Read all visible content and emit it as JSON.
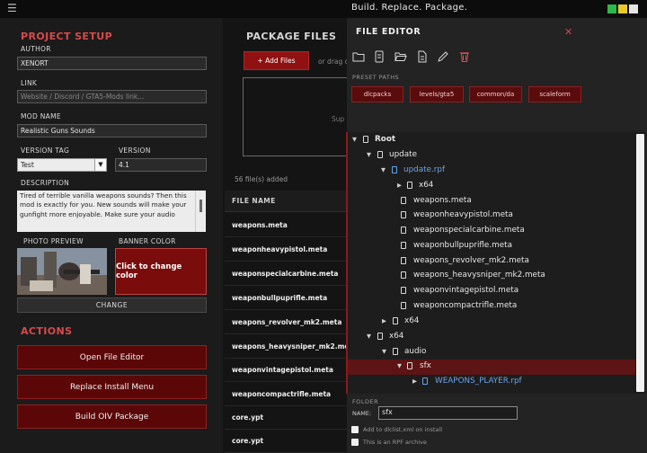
{
  "titlebar": {
    "app_title": "Build. Replace. Package.",
    "window_squares": [
      {
        "name": "green",
        "color": "#2fb84a"
      },
      {
        "name": "yellow",
        "color": "#e8c92a"
      },
      {
        "name": "white",
        "color": "#e6e6e6"
      }
    ]
  },
  "setup": {
    "title": "PROJECT SETUP",
    "author": {
      "label": "AUTHOR",
      "value": "XENORT"
    },
    "link": {
      "label": "LINK",
      "placeholder": "Website / Discord / GTA5-Mods link..."
    },
    "mod_name": {
      "label": "MOD NAME",
      "value": "Realistic Guns Sounds"
    },
    "version_tag": {
      "label": "VERSION TAG",
      "value": "Test"
    },
    "version": {
      "label": "VERSION",
      "value": "4.1"
    },
    "description": {
      "label": "DESCRIPTION",
      "value": "Tired of terrible vanilla weapons sounds? Then this mod is exactly for you. New sounds will make your gunfight more enjoyable. Make sure your audio"
    },
    "photo_preview_label": "PHOTO PREVIEW",
    "banner_color_label": "BANNER COLOR",
    "banner_button": "Click to change color",
    "change_button": "CHANGE"
  },
  "actions": {
    "title": "ACTIONS",
    "open_editor": "Open File Editor",
    "replace_menu": "Replace Install Menu",
    "build_oiv": "Build OIV Package"
  },
  "package": {
    "title": "PACKAGE FILES",
    "add_button": "+ Add Files",
    "drop_hint": "or drag o",
    "drop_sub": "Sup",
    "file_count": "56 file(s) added",
    "column_header": "FILE NAME",
    "files": [
      "weapons.meta",
      "weaponheavypistol.meta",
      "weaponspecialcarbine.meta",
      "weaponbullpuprifle.meta",
      "weapons_revolver_mk2.meta",
      "weapons_heavysniper_mk2.meta",
      "weaponvintagepistol.meta",
      "weaponcompactrifle.meta",
      "core.ypt",
      "core.ypt"
    ]
  },
  "editor": {
    "title": "FILE EDITOR",
    "toolbar": [
      "new-folder-icon",
      "new-file-icon",
      "open-folder-icon",
      "document-icon",
      "rename-pencil-icon",
      "delete-trash-icon"
    ],
    "preset_label": "PRESET PATHS",
    "presets": [
      "dlcpacks",
      "levels/gta5",
      "common/da",
      "scaleform"
    ],
    "tree": [
      {
        "label": "Root",
        "arrow": "▼",
        "style": "bold"
      },
      {
        "label": "update",
        "arrow": "▼",
        "style": ""
      },
      {
        "label": "update.rpf",
        "arrow": "▼",
        "style": "blue"
      },
      {
        "label": "x64",
        "arrow": "▶",
        "style": ""
      },
      {
        "label": "weapons.meta",
        "arrow": "",
        "style": ""
      },
      {
        "label": "weaponheavypistol.meta",
        "arrow": "",
        "style": ""
      },
      {
        "label": "weaponspecialcarbine.meta",
        "arrow": "",
        "style": ""
      },
      {
        "label": "weaponbullpuprifle.meta",
        "arrow": "",
        "style": ""
      },
      {
        "label": "weapons_revolver_mk2.meta",
        "arrow": "",
        "style": ""
      },
      {
        "label": "weapons_heavysniper_mk2.meta",
        "arrow": "",
        "style": ""
      },
      {
        "label": "weaponvintagepistol.meta",
        "arrow": "",
        "style": ""
      },
      {
        "label": "weaponcompactrifle.meta",
        "arrow": "",
        "style": ""
      },
      {
        "label": "x64",
        "arrow": "▶",
        "style": ""
      },
      {
        "label": "x64",
        "arrow": "▼",
        "style": ""
      },
      {
        "label": "audio",
        "arrow": "▼",
        "style": ""
      },
      {
        "label": "sfx",
        "arrow": "▼",
        "style": "selected"
      },
      {
        "label": "WEAPONS_PLAYER.rpf",
        "arrow": "▶",
        "style": "blue"
      }
    ],
    "folder_label": "FOLDER",
    "name_label": "NAME:",
    "name_value": "sfx",
    "checkbox1": "Add to dlclist.xml on install",
    "checkbox2": "This is an RPF archive"
  }
}
